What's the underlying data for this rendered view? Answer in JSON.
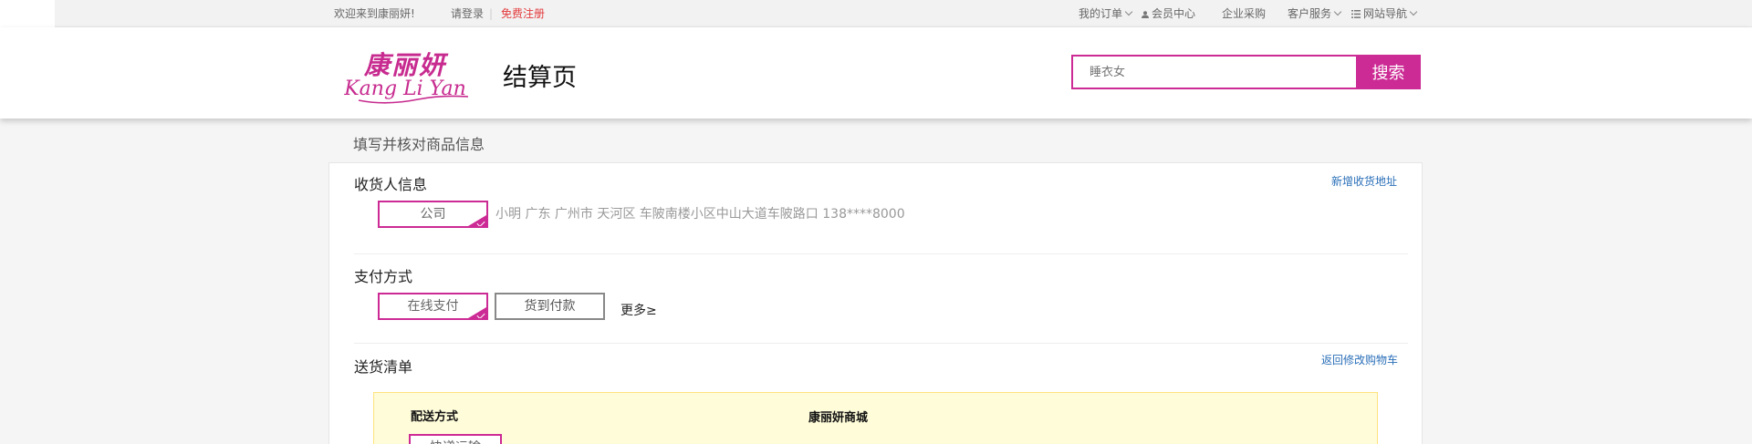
{
  "topbar": {
    "welcome": "欢迎来到康丽妍!",
    "login": "请登录",
    "divider": "|",
    "register": "免费注册",
    "my_orders": "我的订单",
    "member_center": "会员中心",
    "enterprise": "企业采购",
    "customer_service": "客户服务",
    "site_nav": "网站导航"
  },
  "header": {
    "logo_cn": "康丽妍",
    "logo_en": "Kang Li Yan",
    "page_title": "结算页",
    "search_placeholder": "睡衣女",
    "search_button": "搜索"
  },
  "section_title": "填写并核对商品信息",
  "receiver": {
    "title": "收货人信息",
    "add_link": "新增收货地址",
    "tag": "公司",
    "address": "小明 广东 广州市 天河区 车陂南楼小区中山大道车陂路口 138****8000"
  },
  "payment": {
    "title": "支付方式",
    "online": "在线支付",
    "cod": "货到付款",
    "more": "更多≥"
  },
  "delivery_list": {
    "title": "送货清单",
    "back_link": "返回修改购物车",
    "method_label": "配送方式",
    "store_label": "康丽妍商城",
    "method_option": "快递运输"
  },
  "colors": {
    "brand": "#cc2a94",
    "link": "#2a6fb8",
    "register": "#e4393c",
    "delivery_bg": "#fffcd9"
  }
}
